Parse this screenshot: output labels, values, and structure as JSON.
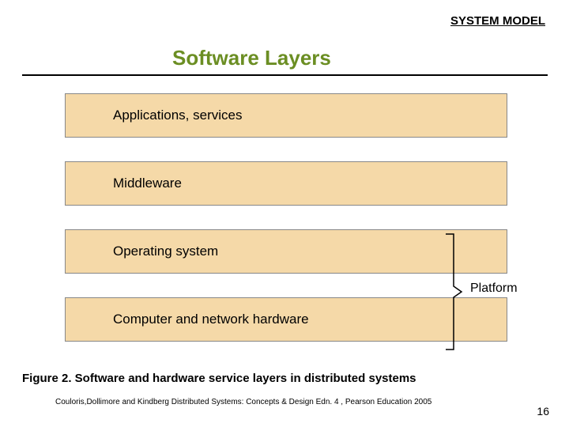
{
  "header": "SYSTEM MODEL",
  "title": "Software Layers",
  "layers": {
    "l0": "Applications, services",
    "l1": "Middleware",
    "l2": "Operating system",
    "l3": "Computer and network hardware"
  },
  "platform_label": "Platform",
  "caption": "Figure 2. Software and hardware service layers in distributed systems",
  "citation": "Couloris,Dollimore and Kindberg  Distributed Systems: Concepts & Design  Edn. 4 , Pearson Education 2005",
  "page_number": "16"
}
